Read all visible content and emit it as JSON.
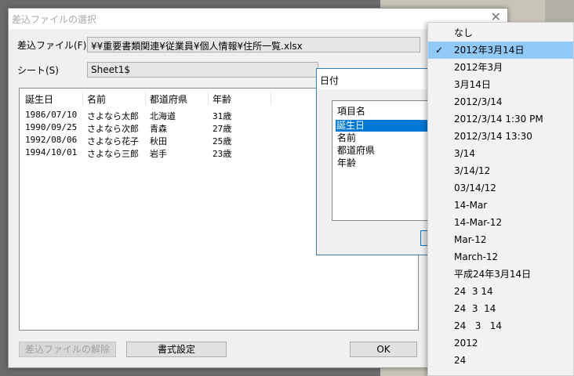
{
  "dialog": {
    "title": "差込ファイルの選択",
    "close": "✕",
    "file_label": "差込ファイル(F)",
    "file_value": "¥¥重要書類関連¥従業員¥個人情報¥住所一覧.xlsx",
    "sheet_label": "シート(S)",
    "sheet_value": "Sheet1$",
    "columns": [
      "誕生日",
      "名前",
      "都道府県",
      "年齢"
    ],
    "rows": [
      [
        "1986/07/10",
        "さよなら太郎",
        "北海道",
        "31歳"
      ],
      [
        "1990/09/25",
        "さよなら次郎",
        "青森",
        "27歳"
      ],
      [
        "1992/08/06",
        "さよなら花子",
        "秋田",
        "25歳"
      ],
      [
        "1994/10/01",
        "さよなら三郎",
        "岩手",
        "23歳"
      ]
    ],
    "btn_release": "差込ファイルの解除",
    "btn_format": "書式設定",
    "btn_ok": "OK"
  },
  "date_dialog": {
    "title": "日付",
    "header": "項目名",
    "items": [
      "誕生日",
      "名前",
      "都道府県",
      "年齢"
    ],
    "selected_index": 0
  },
  "menu": {
    "items": [
      "なし",
      "2012年3月14日",
      "2012年3月",
      "3月14日",
      "2012/3/14",
      "2012/3/14 1:30 PM",
      "2012/3/14 13:30",
      "3/14",
      "3/14/12",
      "03/14/12",
      "14-Mar",
      "14-Mar-12",
      "Mar-12",
      "March-12",
      "平成24年3月14日",
      "24  3 14",
      "24  3  14",
      "24   3   14",
      "2012",
      "24"
    ],
    "selected_index": 1,
    "check": "✓"
  }
}
